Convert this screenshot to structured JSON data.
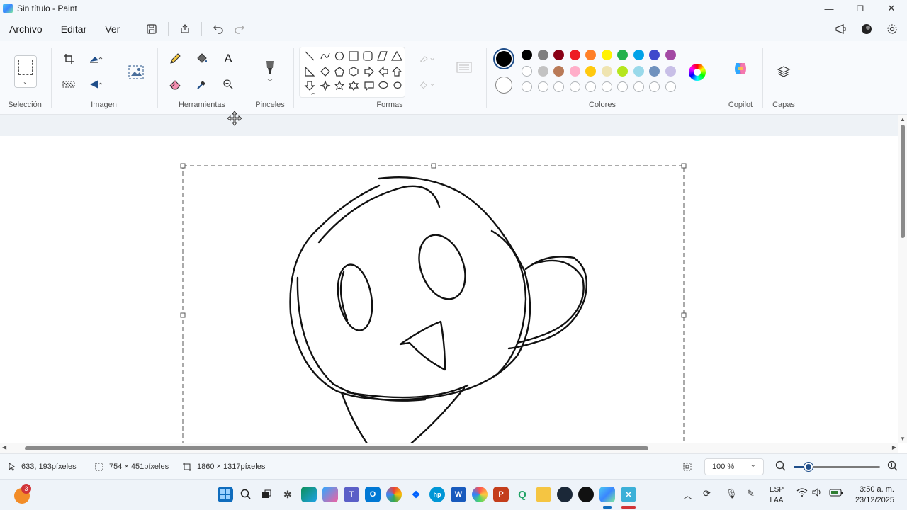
{
  "window": {
    "title": "Sin título - Paint",
    "minimize": "—",
    "maximize": "❐",
    "close": "✕"
  },
  "menu": {
    "file": "Archivo",
    "edit": "Editar",
    "view": "Ver"
  },
  "ribbon": {
    "selection_label": "Selección",
    "image_label": "Imagen",
    "tools_label": "Herramientas",
    "brushes_label": "Pinceles",
    "shapes_label": "Formas",
    "colors_label": "Colores",
    "copilot_label": "Copilot",
    "layers_label": "Capas",
    "text_tool": "A",
    "colors_row1": [
      "#000000",
      "#7f7f7f",
      "#880015",
      "#ed1c24",
      "#ff7f27",
      "#fff200",
      "#22b14c",
      "#00a2e8",
      "#3f48cc",
      "#a349a4"
    ],
    "colors_row2": [
      "#ffffff",
      "#c3c3c3",
      "#b97a57",
      "#ffaec9",
      "#ffc90e",
      "#efe4b0",
      "#b5e61d",
      "#99d9ea",
      "#7092be",
      "#c8bfe7"
    ],
    "primary_color": "#000000",
    "secondary_color": "#ffffff"
  },
  "status": {
    "cursor_pos": "633, 193píxeles",
    "selection_size": "754 × 451píxeles",
    "canvas_size": "1860 × 1317píxeles",
    "zoom": "100 %",
    "zoom_fraction": 0.17
  },
  "taskbar": {
    "notification_count": "3",
    "lang_line1": "ESP",
    "lang_line2": "LAA",
    "time": "3:50 a. m.",
    "date": "23/12/2025"
  }
}
